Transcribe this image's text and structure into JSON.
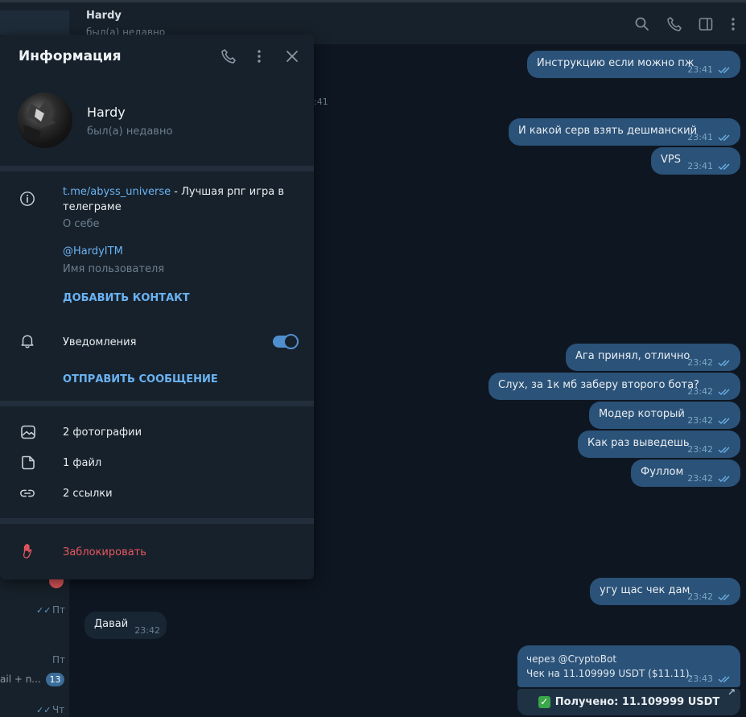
{
  "header": {
    "name": "Hardy",
    "status": "был(а) недавно"
  },
  "chatlist": {
    "day1": "Пт",
    "day2": "Пт",
    "snippet": "ail + n...",
    "unread": "13",
    "day3": "Чт"
  },
  "info_panel": {
    "title": "Информация",
    "name": "Hardy",
    "status": "был(а) недавно",
    "bio_link": "t.me/abyss_universe",
    "bio_text": " - Лучшая рпг игра в телеграме",
    "bio_label": "О себе",
    "username": "@HardyITM",
    "username_label": "Имя пользователя",
    "add_contact": "ДОБАВИТЬ КОНТАКТ",
    "notifications": "Уведомления",
    "notifications_on": true,
    "send_message": "ОТПРАВИТЬ СООБЩЕНИЕ",
    "photos": "2 фотографии",
    "files": "1 файл",
    "links": "2 ссылки",
    "block": "Заблокировать"
  },
  "messages": {
    "stub_time": ":41",
    "m1": {
      "text": "Инструкцию если можно пж",
      "time": "23:41"
    },
    "m2": {
      "text": "И какой серв взять дешманский",
      "time": "23:41"
    },
    "m3": {
      "text": "VPS",
      "time": "23:41"
    },
    "m4": {
      "text": "Ага принял, отлично",
      "time": "23:42"
    },
    "m5": {
      "text": "Слух, за 1к мб заберу второго бота?",
      "time": "23:42"
    },
    "m6": {
      "text": "Модер который",
      "time": "23:42"
    },
    "m7": {
      "text": "Как раз выведешь",
      "time": "23:42"
    },
    "m8": {
      "text": "Фуллом",
      "time": "23:42"
    },
    "m9": {
      "text": "угу щас чек дам",
      "time": "23:42"
    },
    "in1": {
      "text": "Давай",
      "time": "23:42"
    },
    "bot": {
      "line1": "через @CryptoBot",
      "line2": "Чек на 11.109999 USDT ($11.11).",
      "time": "23:43",
      "button": "Получено: 11.109999 USDT"
    }
  },
  "colors": {
    "background": "#0e1621",
    "panel": "#17212b",
    "outgoing_bubble": "#2b5278",
    "incoming_bubble": "#182533",
    "link": "#6ab3f3",
    "danger": "#e8575f"
  }
}
